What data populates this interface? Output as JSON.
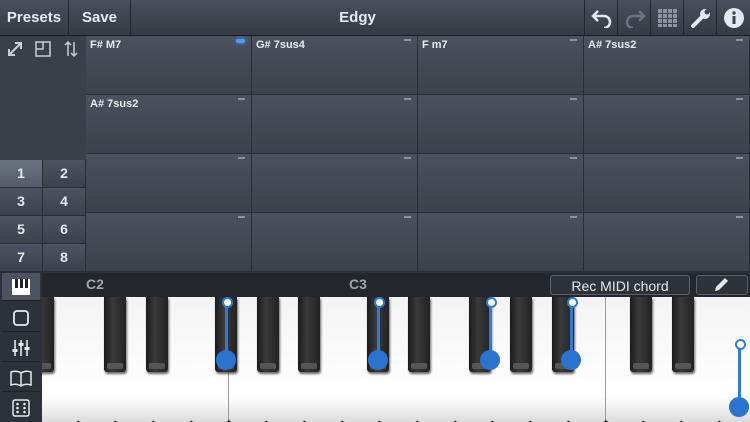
{
  "toolbar": {
    "presets_label": "Presets",
    "save_label": "Save",
    "title": "Edgy",
    "icons": [
      "undo-icon",
      "redo-icon",
      "grid-icon",
      "wrench-icon",
      "info-icon"
    ]
  },
  "tools": [
    "expand-icon",
    "layout-icon",
    "sort-arrows-icon"
  ],
  "pages": [
    "1",
    "2",
    "3",
    "4",
    "5",
    "6",
    "7",
    "8"
  ],
  "selected_page": "1",
  "chords": [
    {
      "label": "F# M7",
      "active": true
    },
    {
      "label": "G# 7sus4",
      "active": false
    },
    {
      "label": "F m7",
      "active": false
    },
    {
      "label": "A# 7sus2",
      "active": false
    },
    {
      "label": "A# 7sus2",
      "active": false
    },
    {
      "label": "",
      "active": false
    },
    {
      "label": "",
      "active": false
    },
    {
      "label": "",
      "active": false
    },
    {
      "label": "",
      "active": false
    },
    {
      "label": "",
      "active": false
    },
    {
      "label": "",
      "active": false
    },
    {
      "label": "",
      "active": false
    },
    {
      "label": "",
      "active": false
    },
    {
      "label": "",
      "active": false
    },
    {
      "label": "",
      "active": false
    },
    {
      "label": "",
      "active": false
    }
  ],
  "keyboard": {
    "octave_labels": [
      "C2",
      "C3"
    ],
    "rec_label": "Rec MIDI chord",
    "side_icons": [
      "piano-icon",
      "square-icon",
      "mixer-icon",
      "book-icon",
      "dice-icon"
    ]
  },
  "colors": {
    "accent": "#2f7bd9",
    "active_marker": "#4d9bff"
  }
}
